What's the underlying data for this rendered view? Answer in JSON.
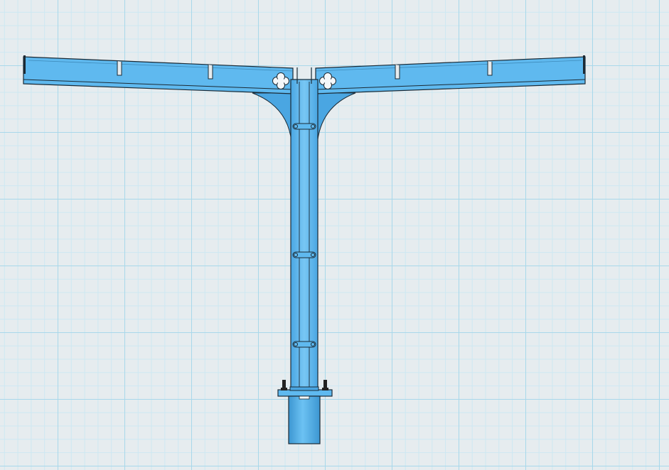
{
  "workplane": {
    "grid": true,
    "grid_color_major": "#a9d8ea",
    "grid_color_minor": "#cde8f2",
    "background": "#e6ecef"
  },
  "model": {
    "shape": "t-shaped-stand",
    "color_main": "#5fb9ef",
    "color_light": "#7fcbf6",
    "color_dark": "#3c96d1",
    "outline": "#1b2a35",
    "icons": [
      "clover-hole-icon",
      "bolt-icon",
      "bracket-icon"
    ]
  }
}
